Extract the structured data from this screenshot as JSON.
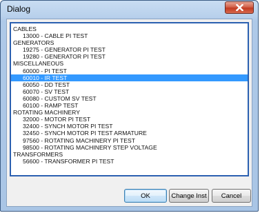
{
  "window": {
    "title": "Dialog"
  },
  "list": {
    "items": [
      {
        "text": "CABLES",
        "kind": "cat"
      },
      {
        "text": "13000 - CABLE PI TEST",
        "kind": "sub"
      },
      {
        "text": "GENERATORS",
        "kind": "cat"
      },
      {
        "text": "19275 - GENERATOR PI TEST",
        "kind": "sub"
      },
      {
        "text": "19280 - GENERATOR PI TEST",
        "kind": "sub"
      },
      {
        "text": "MISCELLANEOUS",
        "kind": "cat"
      },
      {
        "text": "60000 - PI TEST",
        "kind": "sub"
      },
      {
        "text": "60010 - IR TEST",
        "kind": "sub",
        "selected": true
      },
      {
        "text": "60050 - DD TEST",
        "kind": "sub"
      },
      {
        "text": "60070 - SV TEST",
        "kind": "sub"
      },
      {
        "text": "60080 - CUSTOM SV TEST",
        "kind": "sub"
      },
      {
        "text": "60100 - RAMP TEST",
        "kind": "sub"
      },
      {
        "text": "ROTATING MACHINERY",
        "kind": "cat"
      },
      {
        "text": "32000 - MOTOR PI TEST",
        "kind": "sub"
      },
      {
        "text": "32400 - SYNCH MOTOR PI TEST",
        "kind": "sub"
      },
      {
        "text": "32450 - SYNCH MOTOR PI TEST ARMATURE",
        "kind": "sub"
      },
      {
        "text": "97560 - ROTATING MACHINERY PI TEST",
        "kind": "sub"
      },
      {
        "text": "98500 - ROTATING MACHINERY STEP VOLTAGE",
        "kind": "sub"
      },
      {
        "text": "TRANSFORMERS",
        "kind": "cat"
      },
      {
        "text": "56600 - TRANSFORMER PI TEST",
        "kind": "sub"
      }
    ]
  },
  "buttons": {
    "ok": "OK",
    "change_inst": "Change Inst",
    "cancel": "Cancel"
  },
  "colors": {
    "selection": "#3399ff",
    "list_border": "#2a5fb0",
    "close_button": "#c23b22"
  },
  "icons": {
    "close": "close-icon"
  }
}
